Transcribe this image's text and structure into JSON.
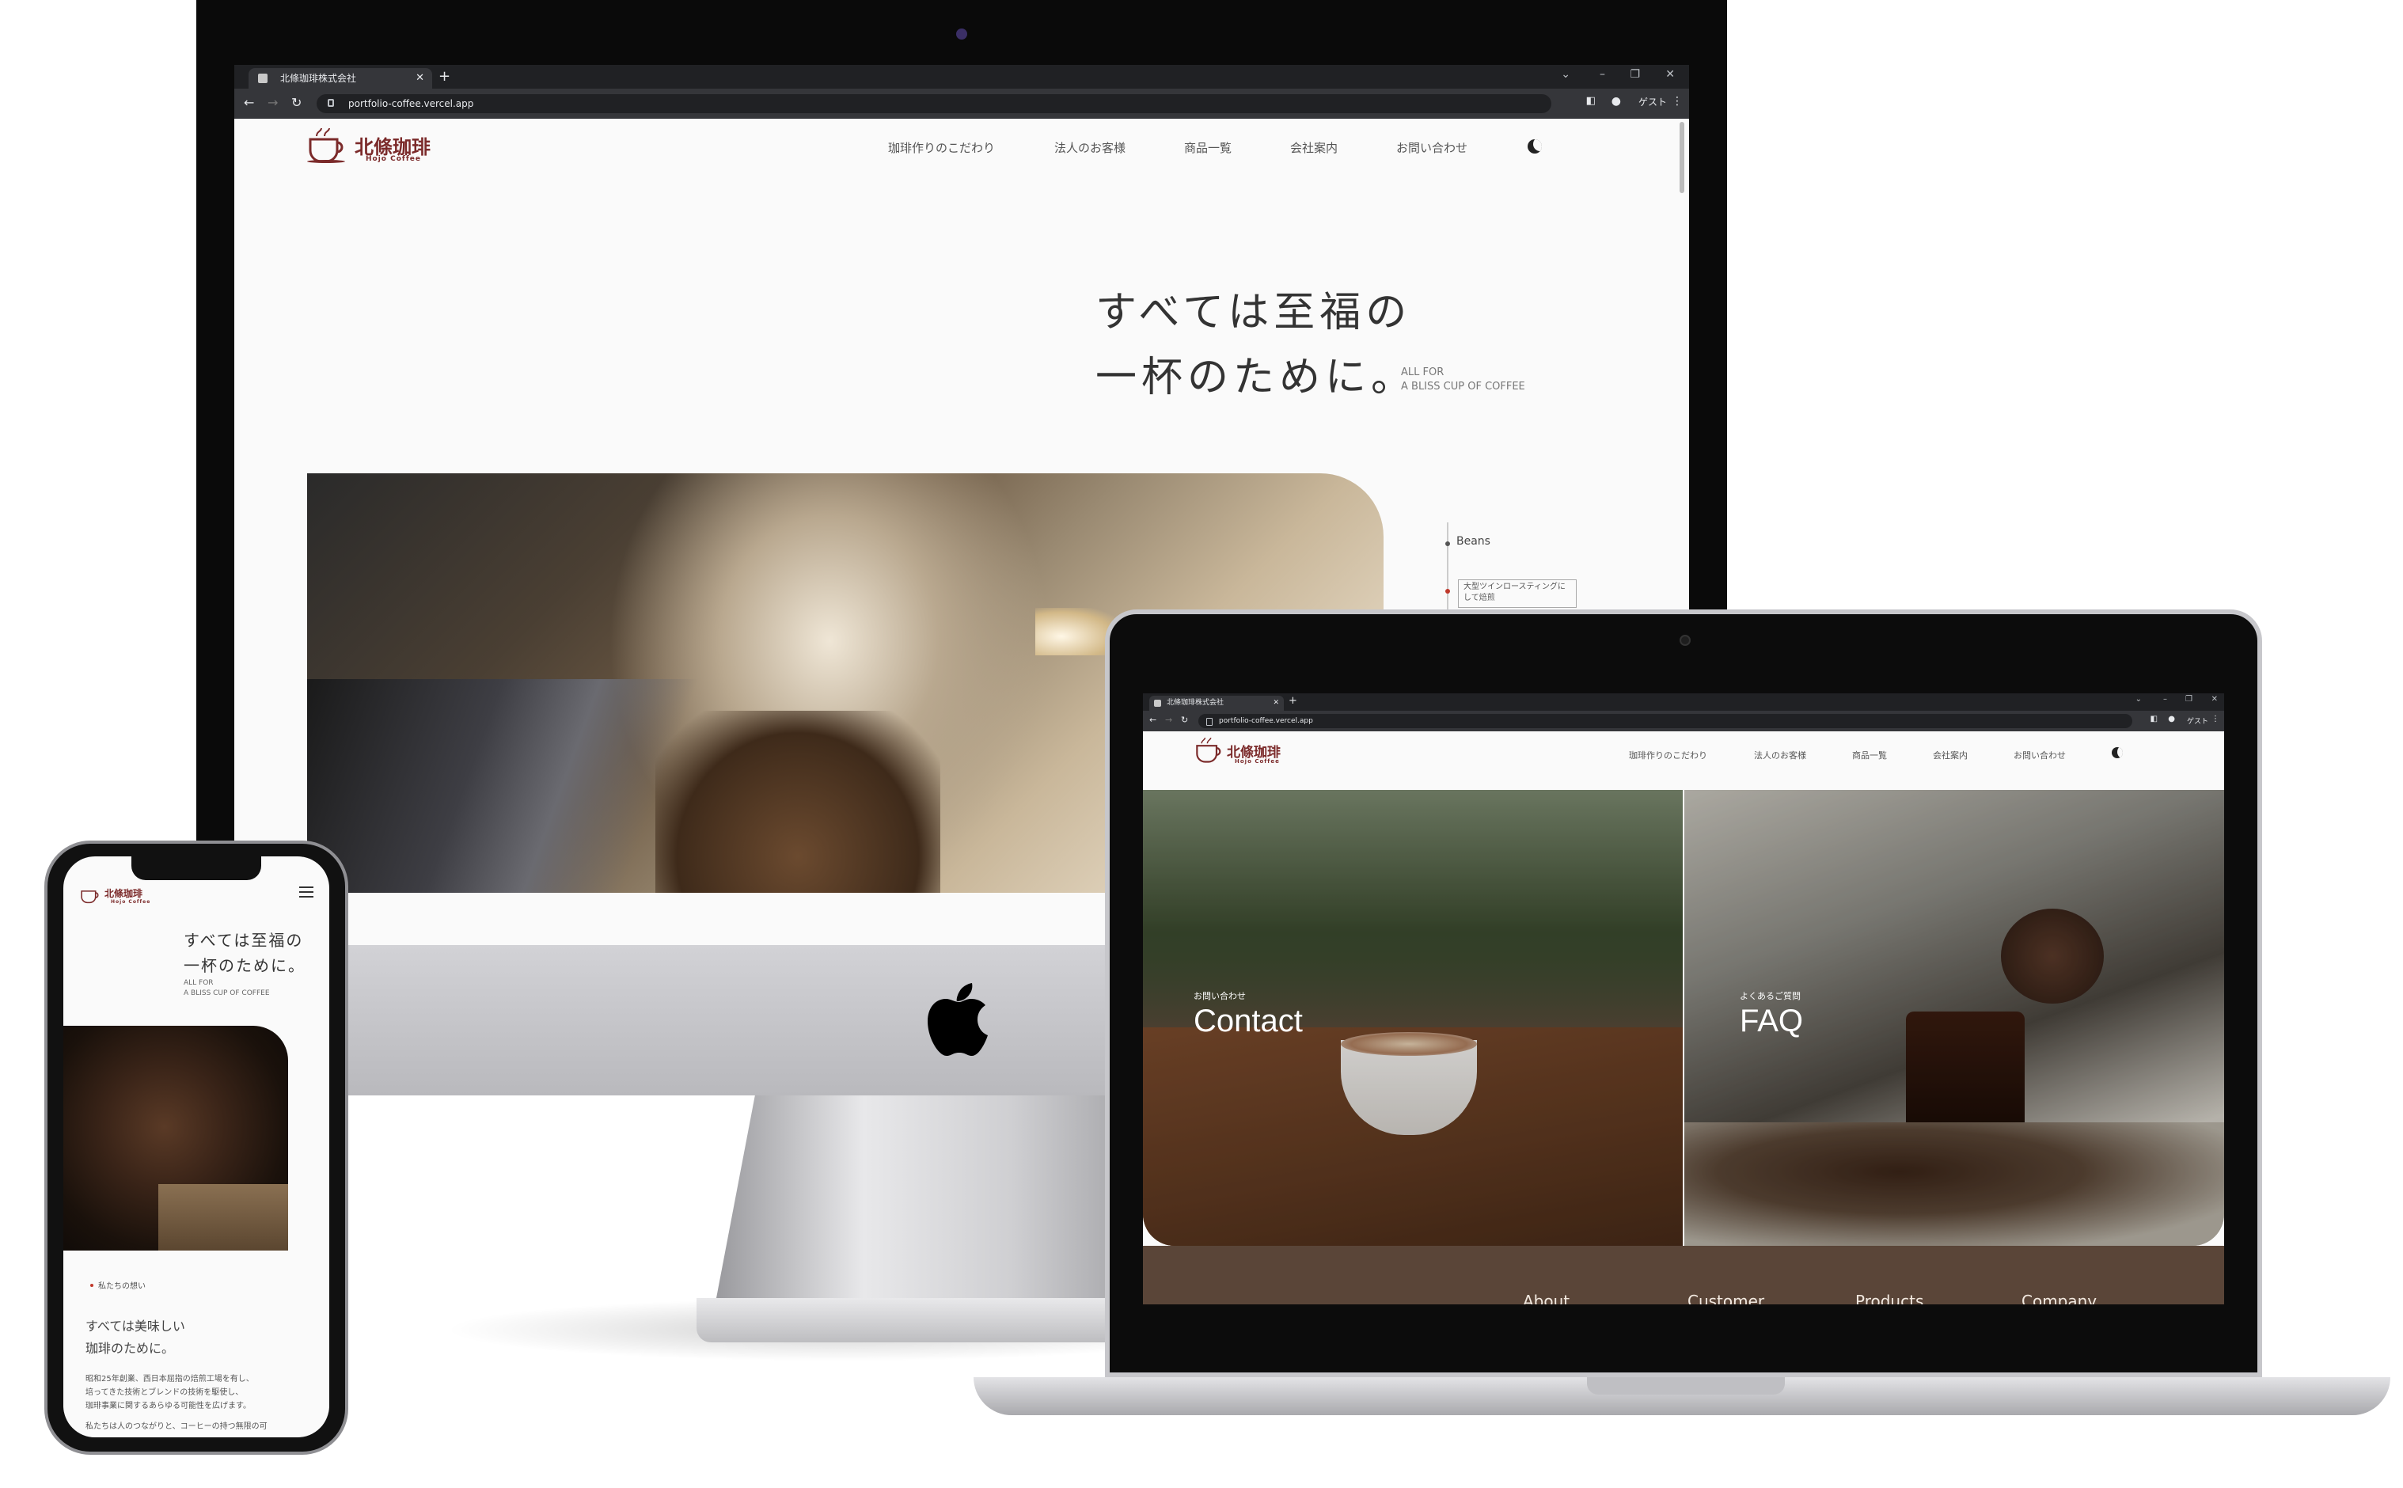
{
  "desktop": {
    "browser": {
      "tab_title": "北條珈琲株式会社",
      "url": "portfolio-coffee.vercel.app",
      "guest_label": "ゲスト"
    },
    "site": {
      "logo_text": "北條珈琲",
      "logo_sub": "Hojo Coffee",
      "nav": [
        "珈琲作りのこだわり",
        "法人のお客様",
        "商品一覧",
        "会社案内",
        "お問い合わせ"
      ],
      "hero_line1": "すべては至福の",
      "hero_line2": "一杯のために。",
      "hero_sub1": "ALL FOR",
      "hero_sub2": "A BLISS CUP OF COFFEE",
      "side_label": "Beans",
      "side_note": "大型ツインロースティングにして焙煎"
    }
  },
  "laptop": {
    "browser": {
      "tab_title": "北條珈琲株式会社",
      "url": "portfolio-coffee.vercel.app",
      "guest_label": "ゲスト"
    },
    "site": {
      "logo_text": "北條珈琲",
      "logo_sub": "Hojo Coffee",
      "nav": [
        "珈琲作りのこだわり",
        "法人のお客様",
        "商品一覧",
        "会社案内",
        "お問い合わせ"
      ],
      "contact_small": "お問い合わせ",
      "contact_big": "Contact",
      "faq_small": "よくあるご質問",
      "faq_big": "FAQ",
      "footer": [
        "About",
        "Customer",
        "Products",
        "Company"
      ]
    }
  },
  "phone": {
    "logo_text": "北條珈琲",
    "logo_sub": "Hojo Coffee",
    "hero_line1": "すべては至福の",
    "hero_line2": "一杯のために。",
    "hero_sub1": "ALL FOR",
    "hero_sub2": "A BLISS CUP OF COFFEE",
    "section_label": "私たちの想い",
    "section_title1": "すべては美味しい",
    "section_title2": "珈琲のために。",
    "body1": "昭和25年創業、西日本屈指の焙煎工場を有し、",
    "body2": "培ってきた技術とブレンドの技術を駆使し、",
    "body3": "珈琲事業に関するあらゆる可能性を広げます。",
    "body4": "私たちは人のつながりと、コーヒーの持つ無限の可"
  },
  "colors": {
    "brand": "#7b2a2a",
    "footer_bg": "#5a4538",
    "accent_dot": "#c0392b"
  }
}
